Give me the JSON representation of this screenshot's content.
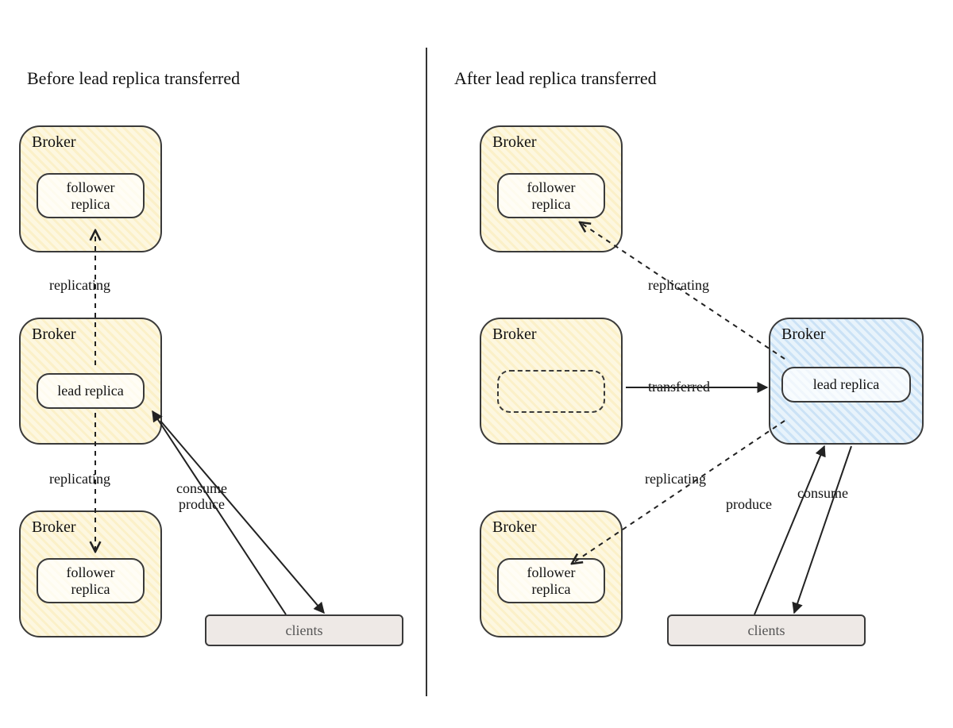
{
  "left": {
    "title": "Before lead replica transferred",
    "broker_label": "Broker",
    "follower_label": "follower\nreplica",
    "lead_label": "lead replica",
    "replicating_label": "replicating",
    "consume_label": "consume",
    "produce_label": "produce",
    "clients_label": "clients"
  },
  "right": {
    "title": "After lead replica transferred",
    "broker_label": "Broker",
    "follower_label": "follower\nreplica",
    "lead_label": "lead replica",
    "transferred_label": "transferred",
    "replicating_label": "replicating",
    "consume_label": "consume",
    "produce_label": "produce",
    "clients_label": "clients"
  },
  "colors": {
    "yellow": "#fdf7e0",
    "blue": "#e8f3fb",
    "stroke": "#3a3a3a"
  }
}
